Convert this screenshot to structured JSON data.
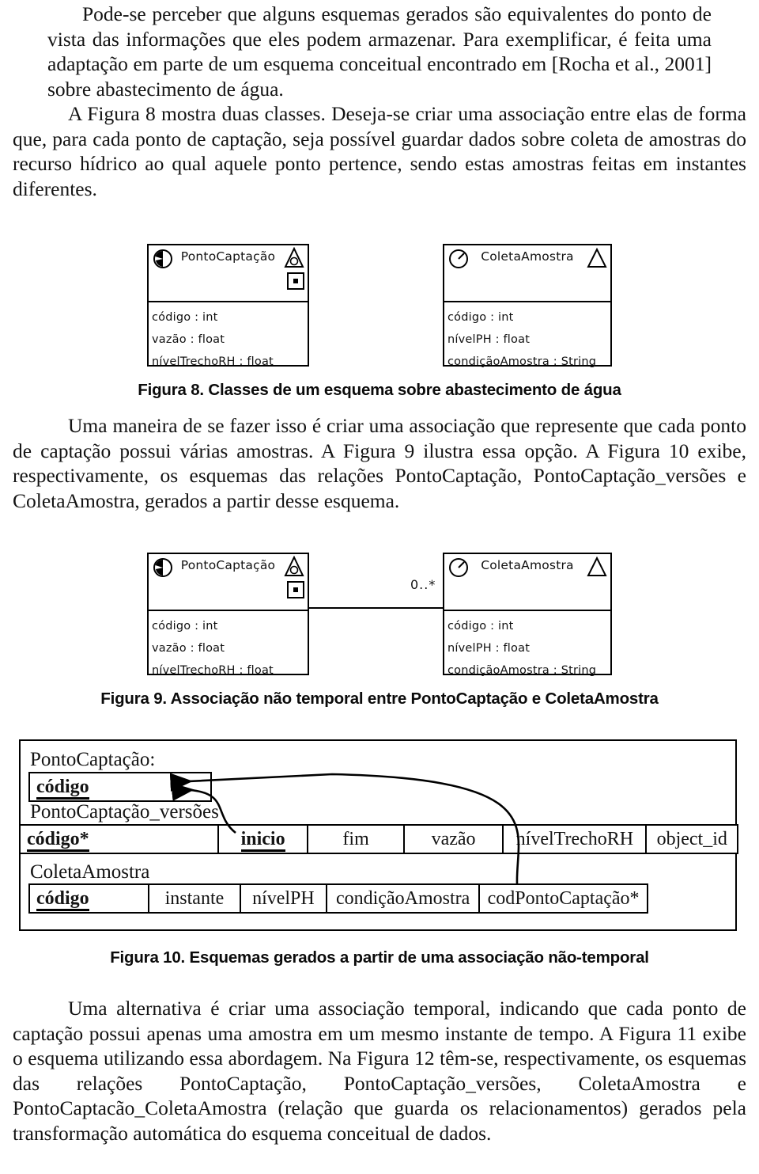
{
  "document": {
    "paragraphs": [
      {
        "id": "p1",
        "text": "Pode-se perceber que alguns esquemas gerados são equivalentes do ponto de vista das informações que eles podem armazenar. Para exemplificar, é feita uma adaptação em parte de um esquema conceitual encontrado em [Rocha et al., 2001] sobre abastecimento de água."
      },
      {
        "id": "p2",
        "text": "A Figura 8 mostra duas classes. Deseja-se criar uma associação entre elas de forma que, para cada ponto de captação, seja possível guardar dados sobre coleta de amostras do recurso hídrico ao qual aquele ponto pertence, sendo estas amostras feitas em instantes diferentes."
      },
      {
        "id": "p3",
        "text": "Uma maneira de se fazer isso é criar uma associação que represente que cada ponto de captação possui várias amostras. A Figura 9 ilustra essa opção. A Figura 10 exibe, respectivamente, os esquemas das relações PontoCaptação, PontoCaptação_versões e ColetaAmostra, gerados a partir desse esquema."
      },
      {
        "id": "p4",
        "text": "Uma alternativa é criar uma associação temporal, indicando que cada ponto de captação possui apenas uma amostra em um mesmo instante de tempo. A Figura 11 exibe o esquema utilizando essa abordagem. Na Figura 12 têm-se, respectivamente, os esquemas das relações PontoCaptação, PontoCaptação_versões, ColetaAmostra e PontoCaptacão_ColetaAmostra (relação que guarda os relacionamentos) gerados pela transformação automática do esquema conceitual de dados."
      }
    ]
  },
  "figure8": {
    "caption": "Figura 8. Classes de um esquema sobre abastecimento de água",
    "classes": [
      {
        "name": "PontoCaptação",
        "icons": [
          "clock-icon",
          "triangle-icon",
          "square-marker-icon"
        ],
        "attributes": [
          "código : int",
          "vazão : float",
          "nívelTrechoRH : float"
        ]
      },
      {
        "name": "ColetaAmostra",
        "icons": [
          "clock-icon",
          "triangle-icon"
        ],
        "attributes": [
          "código : int",
          "nívelPH : float",
          "condiçãoAmostra : String"
        ]
      }
    ]
  },
  "figure9": {
    "caption": "Figura 9. Associação não temporal entre PontoCaptação e ColetaAmostra",
    "multiplicity": "0..*",
    "classes": [
      {
        "name": "PontoCaptação",
        "icons": [
          "clock-icon",
          "triangle-icon",
          "square-marker-icon"
        ],
        "attributes": [
          "código : int",
          "vazão : float",
          "nívelTrechoRH : float"
        ]
      },
      {
        "name": "ColetaAmostra",
        "icons": [
          "clock-icon",
          "triangle-icon"
        ],
        "attributes": [
          "código : int",
          "nívelPH : float",
          "condiçãoAmostra : String"
        ]
      }
    ]
  },
  "figure10": {
    "caption": "Figura 10. Esquemas gerados a partir de uma associação não-temporal",
    "relations": [
      {
        "name": "PontoCaptação:",
        "columns": [
          {
            "label": "código",
            "key": true
          }
        ]
      },
      {
        "name": "PontoCaptação_versões",
        "columns": [
          {
            "label": "código*",
            "key": true
          },
          {
            "label": "inicio",
            "key": true
          },
          {
            "label": "fim",
            "key": false
          },
          {
            "label": "vazão",
            "key": false
          },
          {
            "label": "nívelTrechoRH",
            "key": false
          },
          {
            "label": "object_id",
            "key": false
          }
        ]
      },
      {
        "name": "ColetaAmostra",
        "columns": [
          {
            "label": "código",
            "key": true
          },
          {
            "label": "instante",
            "key": false
          },
          {
            "label": "nívelPH",
            "key": false
          },
          {
            "label": "condiçãoAmostra",
            "key": false
          },
          {
            "label": "codPontoCaptação*",
            "key": false
          }
        ]
      }
    ]
  }
}
